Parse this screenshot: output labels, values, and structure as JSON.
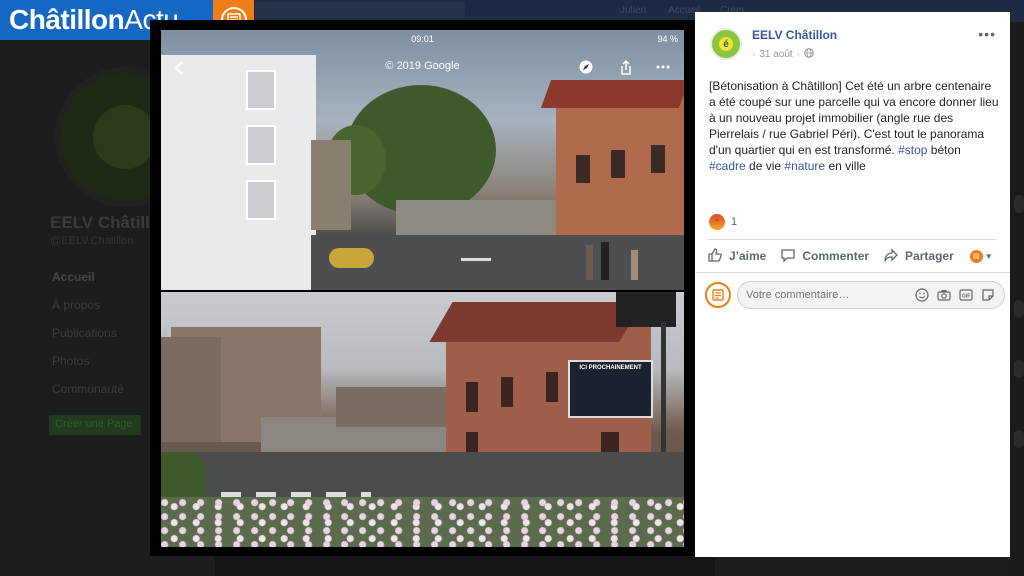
{
  "brand": {
    "name_bold": "Châtillon",
    "name_light": "Actu",
    "icon": "newspaper-icon"
  },
  "background": {
    "page_name": "EELV Châtillon",
    "page_handle": "@EELV.Chatillon",
    "nav": [
      "Accueil",
      "À propos",
      "Publications",
      "Photos",
      "Communauté"
    ],
    "create_page": "Créer une Page",
    "top_user": "Julien",
    "top_home": "Accueil",
    "top_create": "Créer"
  },
  "photo": {
    "status_time": "09:01",
    "battery": "94 %",
    "copyright": "© 2019 Google",
    "sign_title": "ICI PROCHAINEMENT"
  },
  "post": {
    "author": "EELV Châtillon",
    "date": "31 août",
    "text_main": "[Bétonisation à Châtillon] Cet été un arbre centenaire a été coupé sur une parcelle qui va encore donner lieu à un nouveau projet immobilier (angle rue des Pierrelais / rue Gabriel Péri). C'est tout le panorama d'un quartier qui en est transformé.",
    "tags": {
      "stop": "#stop",
      "beton": " béton ",
      "cadre": "#cadre",
      "de_vie": " de vie ",
      "nature": "#nature",
      "en_ville": " en ville"
    },
    "reaction_count": "1",
    "like_label": "J’aime",
    "comment_label": "Commenter",
    "share_label": "Partager",
    "comment_placeholder": "Votre commentaire…"
  },
  "colors": {
    "brand_blue": "#1468c4",
    "brand_orange": "#f07d18",
    "link": "#385898"
  }
}
